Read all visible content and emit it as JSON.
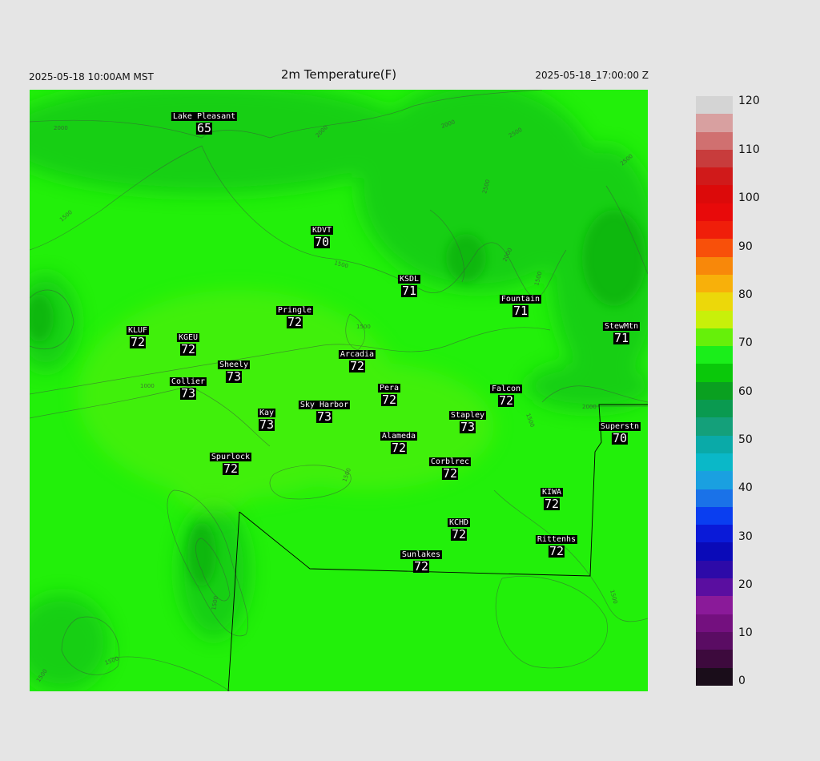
{
  "header": {
    "left": "2025-05-18 10:00AM MST",
    "title": "2m Temperature(F)",
    "right": "2025-05-18_17:00:00 Z"
  },
  "contour_labels": [
    "2000",
    "2000",
    "2000",
    "2500",
    "2500",
    "2000",
    "1500",
    "2500",
    "1500",
    "1500",
    "1500",
    "1000",
    "1500",
    "1500",
    "2000",
    "1500",
    "1500",
    "1500",
    "1500"
  ],
  "stations": [
    {
      "name": "Lake Pleasant",
      "value": "65"
    },
    {
      "name": "KDVT",
      "value": "70"
    },
    {
      "name": "KSDL",
      "value": "71"
    },
    {
      "name": "Fountain",
      "value": "71"
    },
    {
      "name": "StewMtn",
      "value": "71"
    },
    {
      "name": "Pringle",
      "value": "72"
    },
    {
      "name": "KLUF",
      "value": "72"
    },
    {
      "name": "KGEU",
      "value": "72"
    },
    {
      "name": "Arcadia",
      "value": "72"
    },
    {
      "name": "Sheely",
      "value": "73"
    },
    {
      "name": "Collier",
      "value": "73"
    },
    {
      "name": "Pera",
      "value": "72"
    },
    {
      "name": "Falcon",
      "value": "72"
    },
    {
      "name": "Kay",
      "value": "73"
    },
    {
      "name": "Sky Harbor",
      "value": "73"
    },
    {
      "name": "Stapley",
      "value": "73"
    },
    {
      "name": "Superstn",
      "value": "70"
    },
    {
      "name": "Alameda",
      "value": "72"
    },
    {
      "name": "Corblrec",
      "value": "72"
    },
    {
      "name": "Spurlock",
      "value": "72"
    },
    {
      "name": "KIWA",
      "value": "72"
    },
    {
      "name": "KCHD",
      "value": "72"
    },
    {
      "name": "Rittenhs",
      "value": "72"
    },
    {
      "name": "Sunlakes",
      "value": "72"
    }
  ],
  "colorbar": {
    "ticks": [
      "120",
      "110",
      "100",
      "90",
      "80",
      "70",
      "60",
      "50",
      "40",
      "30",
      "20",
      "10",
      "0"
    ],
    "colors": [
      "#1a0d1a",
      "#3d0a3d",
      "#5a0c63",
      "#74107f",
      "#8a1a99",
      "#5a0ea0",
      "#2d0aa8",
      "#0a0ab8",
      "#0a1ad8",
      "#0a3ef0",
      "#1a72e8",
      "#1aa0e0",
      "#0ab8c8",
      "#0aaaa8",
      "#14a07a",
      "#0a9a50",
      "#0aa020",
      "#0ac80a",
      "#1aee1a",
      "#66f00a",
      "#c8f00a",
      "#ecd80a",
      "#f8b00a",
      "#f8880a",
      "#f8500a",
      "#f01e0a",
      "#e80a0a",
      "#dc0a0a",
      "#d01a1a",
      "#c83c3c",
      "#d07070",
      "#d8a0a0",
      "#d4d4d4"
    ]
  }
}
